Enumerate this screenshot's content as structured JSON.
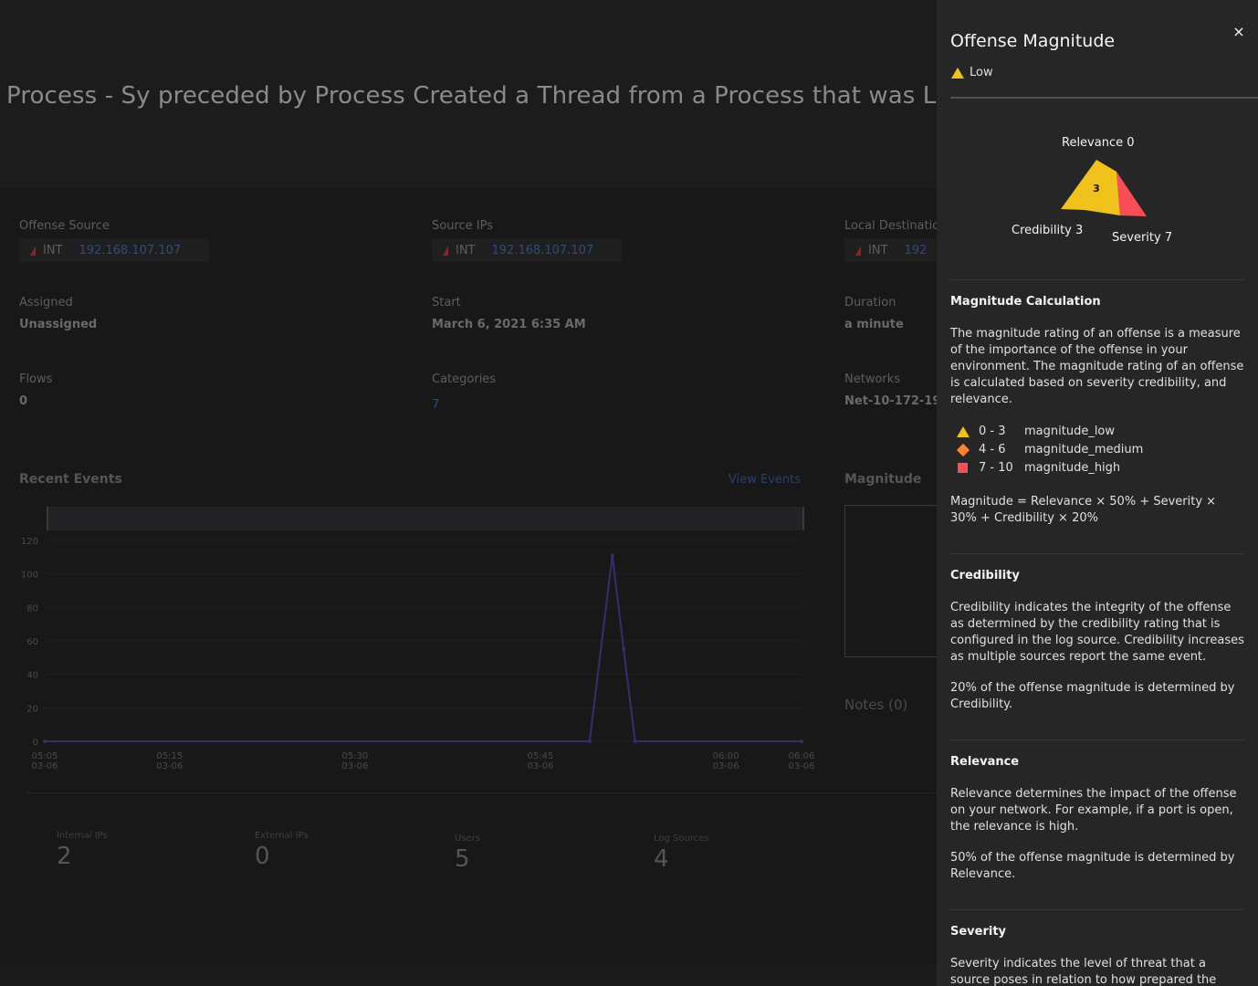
{
  "page": {
    "title": "Process - Sy preceded by Process Created a Thread from a Process that was Laun",
    "fields": {
      "offense_source": {
        "label": "Offense Source",
        "net": "INT",
        "ip": "192.168.107.107"
      },
      "source_ips": {
        "label": "Source IPs",
        "net": "INT",
        "ip": "192.168.107.107"
      },
      "local_destination": {
        "label": "Local Destinatic",
        "net": "INT",
        "ip": "192"
      },
      "assigned": {
        "label": "Assigned",
        "value": "Unassigned"
      },
      "start": {
        "label": "Start",
        "value": "March 6, 2021 6:35 AM"
      },
      "duration": {
        "label": "Duration",
        "value": "a minute"
      },
      "flows": {
        "label": "Flows",
        "value": "0"
      },
      "categories": {
        "label": "Categories",
        "value": "7"
      },
      "networks": {
        "label": "Networks",
        "value": "Net-10-172-19"
      }
    },
    "recent_events": {
      "title": "Recent Events",
      "view_link": "View Events"
    },
    "magnitude_title": "Magnitude",
    "notes_title": "Notes (0)",
    "stats": [
      {
        "label": "Internal IPs",
        "value": "2"
      },
      {
        "label": "External IPs",
        "value": "0"
      },
      {
        "label": "Users",
        "value": "5"
      },
      {
        "label": "Log Sources",
        "value": "4"
      }
    ]
  },
  "chart_data": {
    "type": "line",
    "x": [
      "05:05",
      "05:15",
      "05:30",
      "05:45",
      "06:00",
      "06:06"
    ],
    "x_sublabels": [
      "03-06",
      "03-06",
      "03-06",
      "03-06",
      "03-06",
      "03-06"
    ],
    "series": [
      {
        "points": [
          [
            0,
            0
          ],
          [
            0.72,
            0
          ],
          [
            0.75,
            111
          ],
          [
            0.765,
            55
          ],
          [
            0.78,
            0
          ],
          [
            1.0,
            0
          ]
        ]
      }
    ],
    "yticks": [
      0,
      20,
      40,
      60,
      80,
      100,
      120
    ],
    "ylim": [
      0,
      120
    ],
    "grid": true,
    "line_color": "#3b2a6e"
  },
  "panel": {
    "title": "Offense Magnitude",
    "level": "Low",
    "close_symbol": "×",
    "polygon": {
      "relevance_label": "Relevance 0",
      "credibility_label": "Credibility 3",
      "severity_label": "Severity 7",
      "center_value": "3",
      "colors": {
        "main": "#f1c21b",
        "severity": "#fa4d56"
      }
    },
    "sections": {
      "calc": {
        "heading": "Magnitude Calculation",
        "body": "The magnitude rating of an offense is a measure of the importance of the offense in your environment. The magnitude rating of an offense is calculated based on severity credibility, and relevance.",
        "legend": [
          {
            "range": "0 - 3",
            "name": "magnitude_low",
            "icon": "triangle-icon",
            "color": "#f1c21b"
          },
          {
            "range": "4 - 6",
            "name": "magnitude_medium",
            "icon": "diamond-icon",
            "color": "#ff832b"
          },
          {
            "range": "7 - 10",
            "name": "magnitude_high",
            "icon": "square-icon",
            "color": "#fa4d56"
          }
        ],
        "formula": "Magnitude = Relevance × 50% + Severity × 30% + Credibility × 20%"
      },
      "credibility": {
        "heading": "Credibility",
        "body": "Credibility indicates the integrity of the offense as determined by the credibility rating that is configured in the log source. Credibility increases as multiple sources report the same event.",
        "note": "20% of the offense magnitude is determined by Credibility."
      },
      "relevance": {
        "heading": "Relevance",
        "body": "Relevance determines the impact of the offense on your network. For example, if a port is open, the relevance is high.",
        "note": "50% of the offense magnitude is determined by Relevance."
      },
      "severity": {
        "heading": "Severity",
        "body": "Severity indicates the level of threat that a source poses in relation to how prepared the destination"
      }
    }
  }
}
